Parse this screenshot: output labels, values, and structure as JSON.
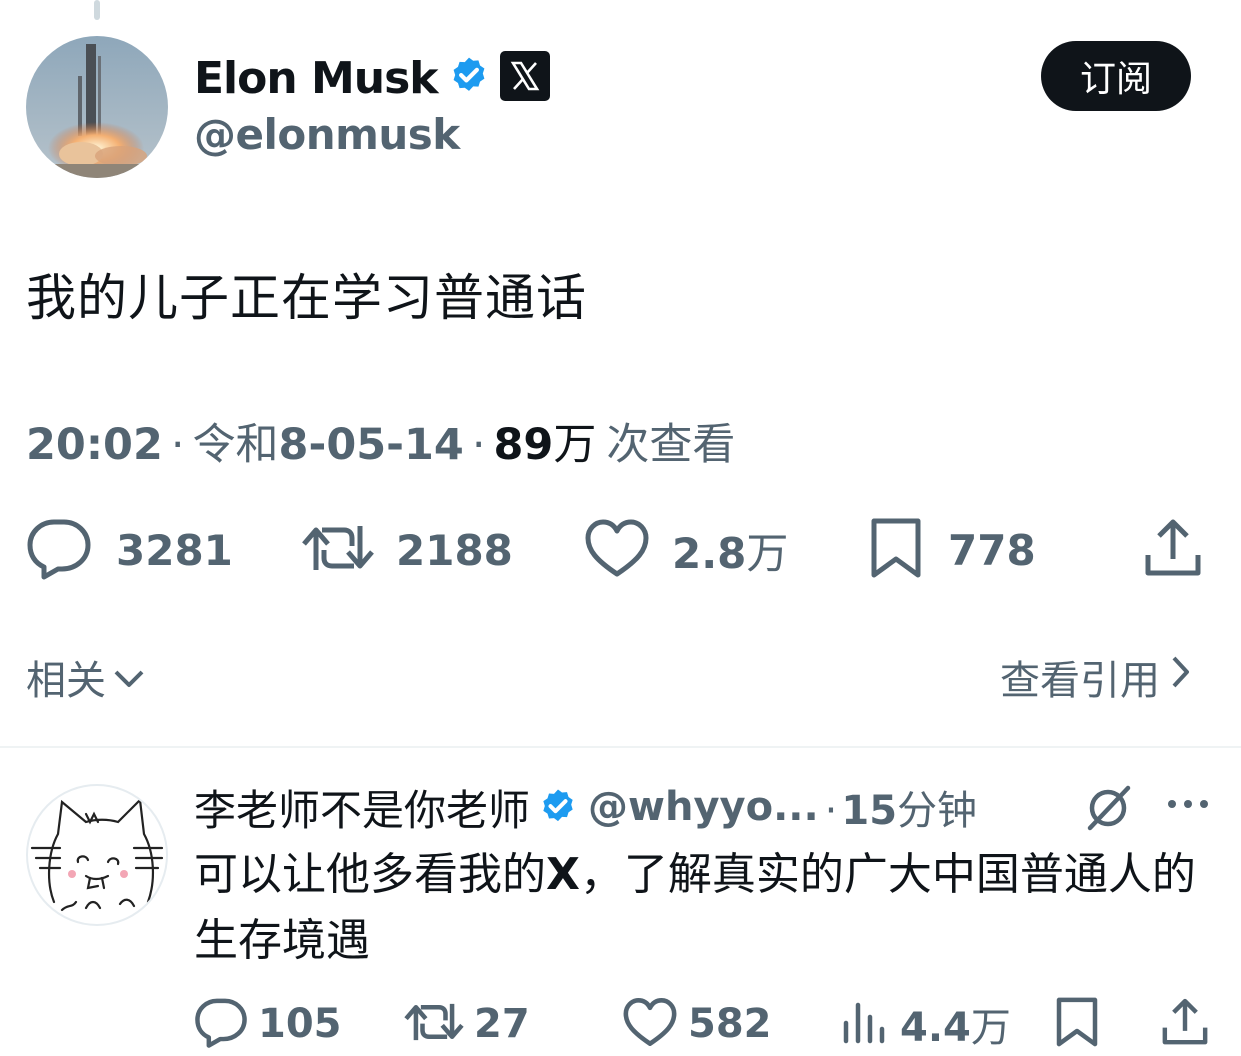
{
  "tweet": {
    "author_name": "Elon Musk",
    "author_handle": "@elonmusk",
    "subscribe_label": "订阅",
    "text": "我的儿子正在学习普通话",
    "time": "20:02",
    "date_prefix": "令和",
    "date": "8-05-14",
    "views_number": "89",
    "views_unit": "万",
    "views_label": "次查看",
    "stats": {
      "replies": "3281",
      "retweets": "2188",
      "likes_number": "2.8",
      "likes_unit": "万",
      "bookmarks": "778"
    },
    "related_label": "相关",
    "view_quotes_label": "查看引用"
  },
  "reply": {
    "author_name": "李老师不是你老师",
    "author_handle": "@whyyo...",
    "time_number": "15",
    "time_unit": "分钟",
    "text_part1": "可以让他多看我的",
    "text_bold": "X",
    "text_part2": "，了解真实的广大中国普通人的生存境遇",
    "stats": {
      "replies": "105",
      "retweets": "27",
      "likes": "582",
      "views_number": "4.4",
      "views_unit": "万"
    }
  },
  "icons": {
    "verified": "verified-badge-icon",
    "x_logo": "x-logo-icon",
    "reply": "reply-icon",
    "retweet": "retweet-icon",
    "like": "heart-icon",
    "bookmark": "bookmark-icon",
    "share": "share-icon",
    "views": "views-bar-icon",
    "grok": "grok-icon",
    "more": "more-icon"
  },
  "colors": {
    "text": "#0f1419",
    "secondary": "#536471",
    "verified": "#1d9bf0",
    "button_bg": "#0f1419"
  }
}
